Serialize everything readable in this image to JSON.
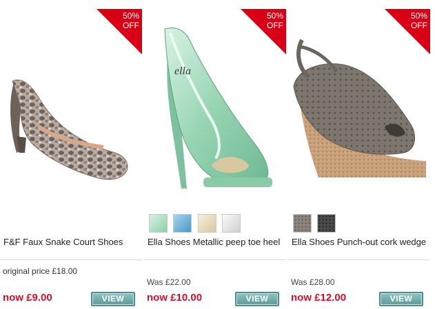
{
  "products": [
    {
      "badge": {
        "line1": "50%",
        "line2": "OFF"
      },
      "image_icon": "snake-court-shoe-image",
      "title": "F&F Faux Snake Court Shoes",
      "price_label": "original price £18.00",
      "now_price": "now £9.00",
      "view_label": "VIEW",
      "swatches": []
    },
    {
      "badge": {
        "line1": "50%",
        "line2": "OFF"
      },
      "image_icon": "metallic-peep-toe-shoe-image",
      "title": "Ella Shoes Metallic peep toe heel",
      "price_label": "Was £22.00",
      "now_price": "now £10.00",
      "view_label": "VIEW",
      "swatches": [
        "#a8dcc0",
        "#62a8d0",
        "#e6dcc2",
        "#e2e2e2"
      ]
    },
    {
      "badge": {
        "line1": "50%",
        "line2": "OFF"
      },
      "image_icon": "punch-out-cork-wedge-image",
      "title": "Ella Shoes Punch-out cork wedge",
      "price_label": "Was £28.00",
      "now_price": "now £12.00",
      "view_label": "VIEW",
      "swatches": [
        "#8a847c",
        "#333333"
      ]
    }
  ],
  "colors": {
    "badge_red": "#d90016",
    "price_red": "#d8102a",
    "button_teal": "#5c9a9a"
  }
}
